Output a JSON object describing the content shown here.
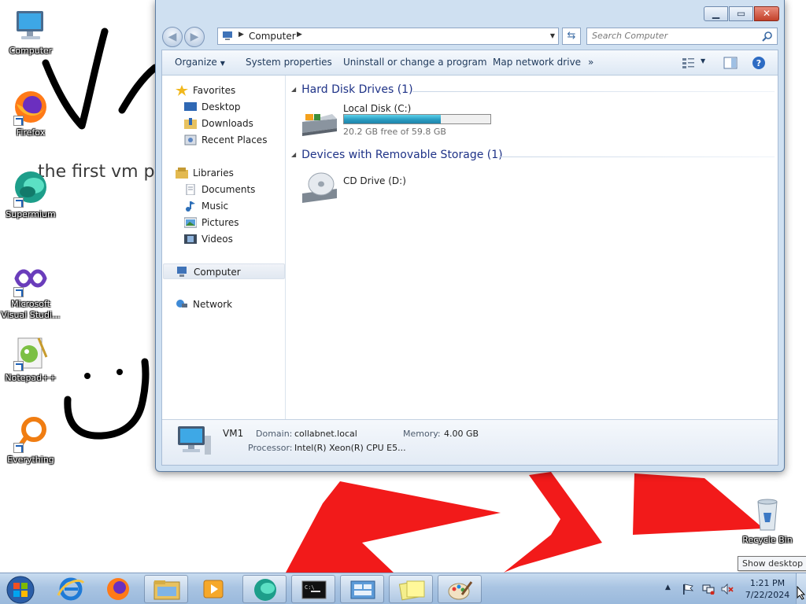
{
  "desktop": {
    "wallpaper_text": "the first vm pro",
    "icons": [
      {
        "label": "Computer"
      },
      {
        "label": "Firefox"
      },
      {
        "label": "Supermium"
      },
      {
        "label": "Microsoft Visual Studi..."
      },
      {
        "label": "Notepad++"
      },
      {
        "label": "Everything"
      },
      {
        "label": "Recycle Bin"
      }
    ]
  },
  "explorer": {
    "address": {
      "path": "Computer"
    },
    "search": {
      "placeholder": "Search Computer"
    },
    "toolbar": {
      "organize": "Organize",
      "system_properties": "System properties",
      "uninstall": "Uninstall or change a program",
      "map_drive": "Map network drive",
      "more": "»"
    },
    "nav": {
      "favorites": "Favorites",
      "desktop": "Desktop",
      "downloads": "Downloads",
      "recent": "Recent Places",
      "libraries": "Libraries",
      "documents": "Documents",
      "music": "Music",
      "pictures": "Pictures",
      "videos": "Videos",
      "computer": "Computer",
      "network": "Network"
    },
    "groups": {
      "hdd": "Hard Disk Drives (1)",
      "removable": "Devices with Removable Storage (1)"
    },
    "drives": {
      "c_name": "Local Disk (C:)",
      "c_free": "20.2 GB free of 59.8 GB",
      "c_used_fraction": 0.662,
      "d_name": "CD Drive (D:)"
    },
    "details": {
      "name": "VM1",
      "domain_label": "Domain:",
      "domain": "collabnet.local",
      "memory_label": "Memory:",
      "memory": "4.00 GB",
      "processor_label": "Processor:",
      "processor": "Intel(R) Xeon(R) CPU E5..."
    }
  },
  "taskbar": {
    "time": "1:21 PM",
    "date": "7/22/2024",
    "tooltip": "Show desktop"
  },
  "colors": {
    "wallpaper_red": "#f21a1a",
    "taskbar": "#a9c4e2",
    "group_header": "#1e3287",
    "disk_bar": "#2a9cc1"
  }
}
